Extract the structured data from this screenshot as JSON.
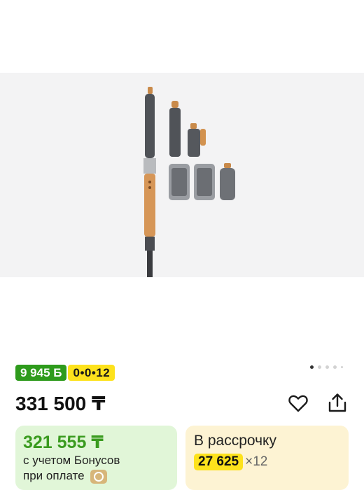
{
  "product": {
    "image_alt": "Dyson Airwrap multi-styler with attachments",
    "carousel": {
      "total": 5,
      "active": 1
    }
  },
  "badges": {
    "bonus": "9 945 Б",
    "installment": "0•0•12"
  },
  "price": {
    "main": "331 500 ₸"
  },
  "actions": {
    "favorite_icon": "heart-icon",
    "share_icon": "share-icon"
  },
  "bonus_card": {
    "price": "321 555 ₸",
    "line1": "с учетом Бонусов",
    "line2": "при оплате"
  },
  "installment_card": {
    "title": "В рассрочку",
    "monthly": "27 625",
    "term": "×12"
  },
  "colors": {
    "bonus_green": "#2e9b1c",
    "installment_yellow": "#fde21c",
    "bonus_card_bg": "#e1f6d8",
    "installment_card_bg": "#fdf3d3"
  }
}
